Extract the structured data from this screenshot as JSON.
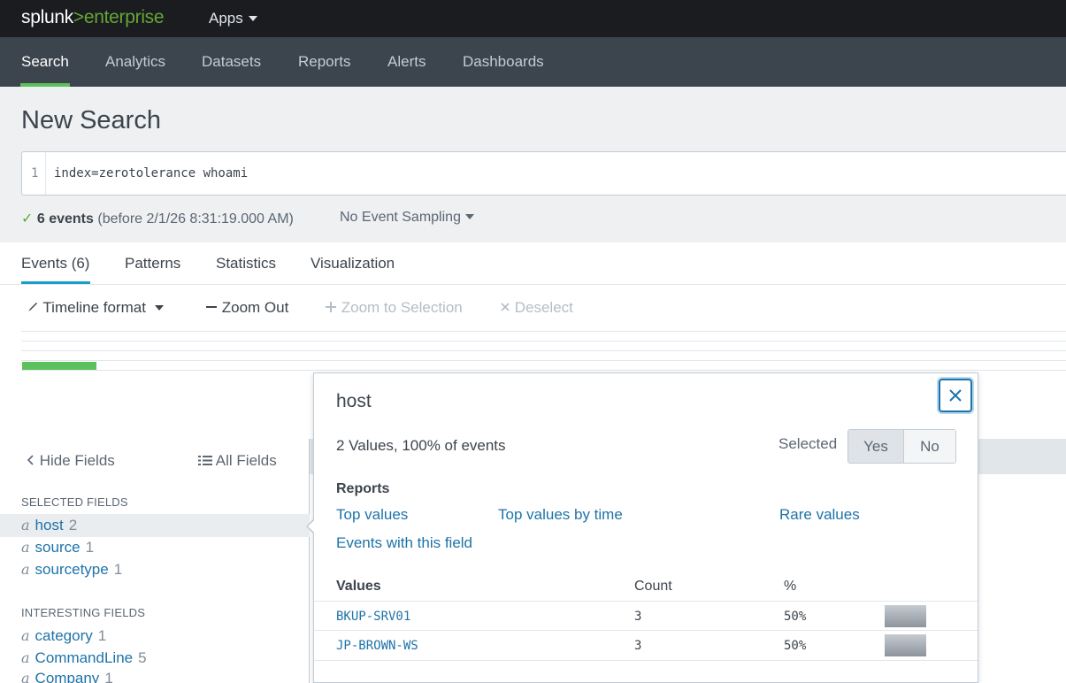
{
  "topbar": {
    "logo_splunk": "splunk",
    "logo_gt": ">",
    "logo_product": "enterprise",
    "apps_label": "Apps"
  },
  "nav": {
    "items": [
      "Search",
      "Analytics",
      "Datasets",
      "Reports",
      "Alerts",
      "Dashboards"
    ],
    "active": "Search"
  },
  "search": {
    "title": "New Search",
    "line_number": "1",
    "query": "index=zerotolerance whoami",
    "status_check": "✓",
    "events_count": "6 events",
    "events_time": "(before 2/1/26 8:31:19.000 AM)",
    "sampling": "No Event Sampling"
  },
  "tabs": [
    "Events (6)",
    "Patterns",
    "Statistics",
    "Visualization"
  ],
  "timeline": {
    "format": "Timeline format",
    "zoom_out": "Zoom Out",
    "zoom_selection": "Zoom to Selection",
    "deselect": "Deselect"
  },
  "sidebar": {
    "hide_fields": "Hide Fields",
    "all_fields": "All Fields",
    "selected_heading": "SELECTED FIELDS",
    "selected_fields": [
      {
        "type": "a",
        "name": "host",
        "count": "2"
      },
      {
        "type": "a",
        "name": "source",
        "count": "1"
      },
      {
        "type": "a",
        "name": "sourcetype",
        "count": "1"
      }
    ],
    "interesting_heading": "INTERESTING FIELDS",
    "interesting_fields": [
      {
        "type": "a",
        "name": "category",
        "count": "1"
      },
      {
        "type": "a",
        "name": "CommandLine",
        "count": "5"
      },
      {
        "type": "a",
        "name": "Company",
        "count": "1"
      }
    ]
  },
  "popover": {
    "title": "host",
    "summary": "2 Values, 100% of events",
    "selected_label": "Selected",
    "yes": "Yes",
    "no": "No",
    "selected_value": "Yes",
    "reports_heading": "Reports",
    "links": {
      "top_values": "Top values",
      "top_values_time": "Top values by time",
      "rare_values": "Rare values",
      "events_with_field": "Events with this field"
    },
    "values_head": {
      "values": "Values",
      "count": "Count",
      "pct": "%"
    },
    "rows": [
      {
        "value": "BKUP-SRV01",
        "count": "3",
        "pct": "50%"
      },
      {
        "value": "JP-BROWN-WS",
        "count": "3",
        "pct": "50%"
      }
    ]
  }
}
